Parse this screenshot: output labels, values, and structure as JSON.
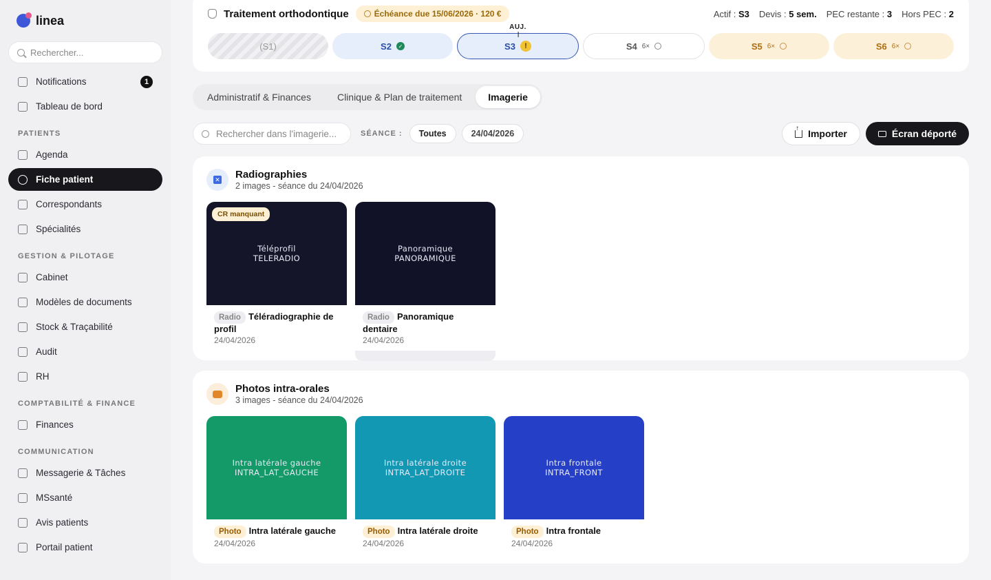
{
  "app": {
    "name": "linea"
  },
  "sidebar": {
    "search_placeholder": "Rechercher...",
    "top_items": [
      {
        "label": "Notifications",
        "badge": "1"
      },
      {
        "label": "Tableau de bord"
      }
    ],
    "sections": [
      {
        "title": "PATIENTS",
        "items": [
          "Agenda",
          "Fiche patient",
          "Correspondants",
          "Spécialités"
        ]
      },
      {
        "title": "GESTION & PILOTAGE",
        "items": [
          "Cabinet",
          "Modèles de documents",
          "Stock & Traçabilité",
          "Audit",
          "RH"
        ]
      },
      {
        "title": "COMPTABILITÉ & FINANCE",
        "items": [
          "Finances"
        ]
      },
      {
        "title": "COMMUNICATION",
        "items": [
          "Messagerie & Tâches",
          "MSsanté",
          "Avis patients",
          "Portail patient"
        ]
      }
    ],
    "active_item": "Fiche patient"
  },
  "treatment": {
    "title": "Traitement orthodontique",
    "due_badge": "Échéance due 15/06/2026 · 120 €",
    "stats": {
      "actif_label": "Actif :",
      "actif_value": "S3",
      "devis_label": "Devis :",
      "devis_value": "5 sem.",
      "pec_label": "PEC restante :",
      "pec_value": "3",
      "hors_label": "Hors PEC :",
      "hors_value": "2"
    },
    "today_label": "AUJ.",
    "sessions": [
      {
        "label": "(S1)",
        "state": "past"
      },
      {
        "label": "S2",
        "state": "done"
      },
      {
        "label": "S3",
        "state": "current"
      },
      {
        "label": "S4",
        "count": "6×",
        "state": "future"
      },
      {
        "label": "S5",
        "count": "6×",
        "state": "warmup"
      },
      {
        "label": "S6",
        "count": "6×",
        "state": "warmup"
      }
    ]
  },
  "tabs": [
    "Administratif & Finances",
    "Clinique & Plan de traitement",
    "Imagerie"
  ],
  "active_tab": "Imagerie",
  "filters": {
    "search_placeholder": "Rechercher dans l'imagerie...",
    "seance_label": "SÉANCE :",
    "chip_all": "Toutes",
    "chip_date": "24/04/2026",
    "import_label": "Importer",
    "screen_label": "Écran déporté"
  },
  "radiographies": {
    "title": "Radiographies",
    "subtitle": "2 images - séance du 24/04/2026",
    "items": [
      {
        "thumb_line1": "Téléprofil",
        "thumb_line2": "TELERADIO",
        "tag": "Radio",
        "name": "Téléradiographie de profil",
        "date": "24/04/2026",
        "badge": "CR manquant",
        "color": "#15152a"
      },
      {
        "thumb_line1": "Panoramique",
        "thumb_line2": "PANORAMIQUE",
        "tag": "Radio",
        "name": "Panoramique dentaire",
        "date": "24/04/2026",
        "color": "#111228"
      }
    ]
  },
  "photos": {
    "title": "Photos intra-orales",
    "subtitle": "3 images - séance du 24/04/2026",
    "items": [
      {
        "thumb_line1": "Intra latérale gauche",
        "thumb_line2": "INTRA_LAT_GAUCHE",
        "tag": "Photo",
        "name": "Intra latérale gauche",
        "date": "24/04/2026",
        "color": "#139a68"
      },
      {
        "thumb_line1": "Intra latérale droite",
        "thumb_line2": "INTRA_LAT_DROITE",
        "tag": "Photo",
        "name": "Intra latérale droite",
        "date": "24/04/2026",
        "color": "#1398b4"
      },
      {
        "thumb_line1": "Intra frontale",
        "thumb_line2": "INTRA_FRONT",
        "tag": "Photo",
        "name": "Intra frontale",
        "date": "24/04/2026",
        "color": "#2540c6"
      }
    ]
  }
}
